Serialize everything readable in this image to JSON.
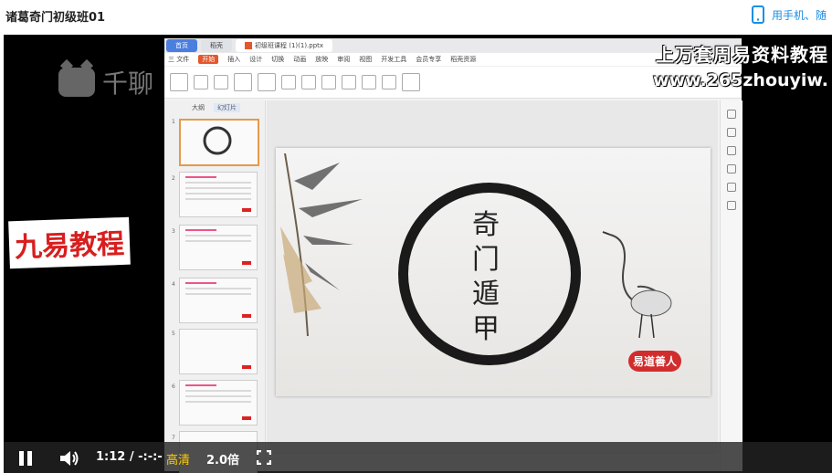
{
  "page": {
    "title": "诸葛奇门初级班01",
    "mobile_link": "用手机、随"
  },
  "overlays": {
    "logo_text": "千聊",
    "red_watermark": "九易教程",
    "wm_line1": "上万套周易资料教程",
    "wm_line2": "www.265zhouyiw."
  },
  "wps": {
    "tabs": [
      "首页",
      "稻壳",
      "初级班课程 (1)(1).pptx"
    ],
    "menu": [
      "三 文件",
      "开始",
      "插入",
      "设计",
      "切换",
      "动画",
      "放映",
      "审阅",
      "视图",
      "开发工具",
      "会员专享",
      "稻壳资源"
    ],
    "menu_active": "开始",
    "panel_tabs": [
      "大纲",
      "幻灯片"
    ],
    "panel_active": "幻灯片",
    "thumb_numbers": [
      "1",
      "2",
      "3",
      "4",
      "5",
      "6",
      "7"
    ]
  },
  "slide": {
    "title_chars": [
      "奇",
      "门",
      "遁",
      "甲"
    ],
    "seal": "易道善人"
  },
  "player": {
    "time": "1:12 / -:-:-",
    "quality": "高清",
    "speed": "2.0倍"
  }
}
